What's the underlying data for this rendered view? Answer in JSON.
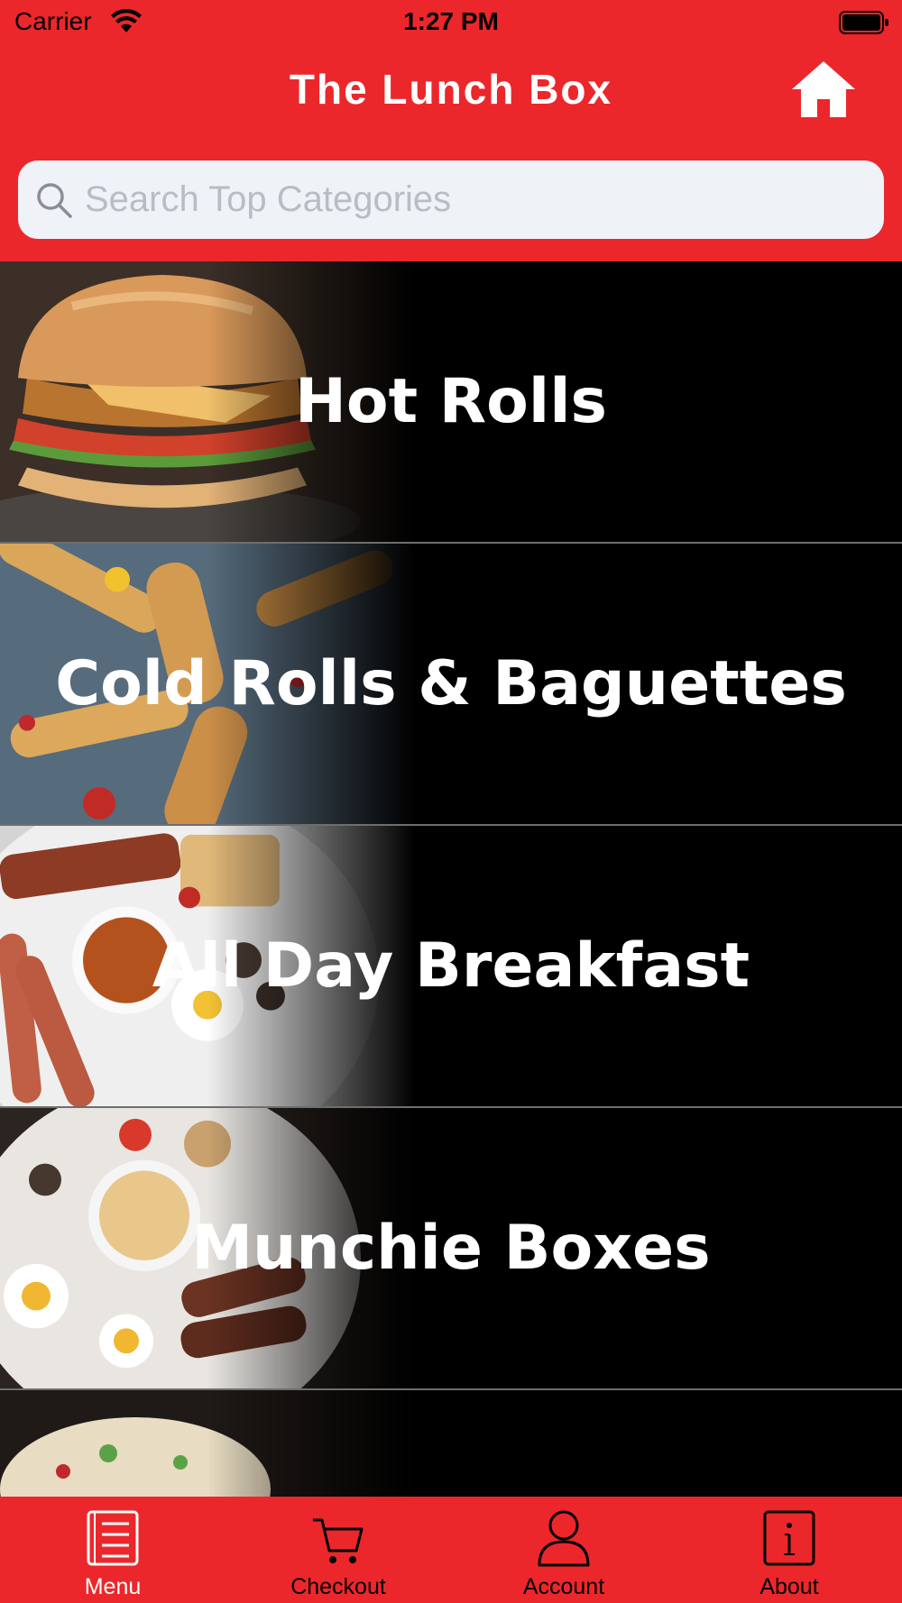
{
  "status_bar": {
    "carrier": "Carrier",
    "time": "1:27 PM"
  },
  "header": {
    "title": "The Lunch Box",
    "home_icon": "home-icon"
  },
  "search": {
    "placeholder": "Search Top Categories",
    "icon": "search-icon"
  },
  "categories": [
    {
      "label": "Hot Rolls"
    },
    {
      "label": "Cold Rolls & Baguettes"
    },
    {
      "label": "All Day Breakfast"
    },
    {
      "label": "Munchie Boxes"
    },
    {
      "label": ""
    }
  ],
  "tabbar": {
    "tabs": [
      {
        "label": "Menu",
        "icon": "menu-book-icon",
        "active": true
      },
      {
        "label": "Checkout",
        "icon": "cart-icon",
        "active": false
      },
      {
        "label": "Account",
        "icon": "user-icon",
        "active": false
      },
      {
        "label": "About",
        "icon": "info-icon",
        "active": false
      }
    ]
  },
  "colors": {
    "brand_red": "#ec272b",
    "search_bg": "#eff2f7",
    "list_bg": "#000000"
  }
}
